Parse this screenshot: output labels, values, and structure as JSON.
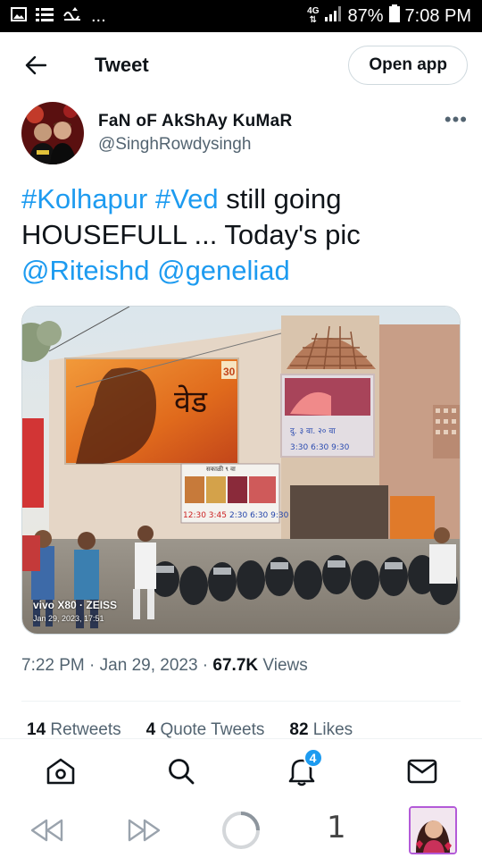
{
  "status_bar": {
    "network": "4G",
    "battery": "87%",
    "time": "7:08 PM",
    "more": "..."
  },
  "header": {
    "title": "Tweet",
    "open_app_label": "Open app"
  },
  "author": {
    "display_name": "FaN oF AkShAy KuMaR",
    "handle": "@SinghRowdysingh",
    "more_label": "•••"
  },
  "tweet": {
    "hashtag1": "#Kolhapur",
    "hashtag2": "#Ved",
    "text1": " still going",
    "text2": "HOUSEFULL ... Today's pic",
    "mention1": "@Riteishd",
    "mention2": "@geneliad"
  },
  "photo": {
    "watermark_line1": "vivo X80 · ZEISS",
    "watermark_line2": "Jan 29, 2023, 17:51",
    "poster_text": "वेड",
    "poster_date": "30",
    "board_text1": "सकाळी ९ वा",
    "board_text2": "12:30  3:45",
    "board_text3": "2:30 6:30 9:30",
    "side_text1": "दु. ३ वा. २० वा",
    "side_text2": "3:30 6:30 9:30"
  },
  "meta": {
    "time": "7:22 PM",
    "sep1": " · ",
    "date": "Jan 29, 2023",
    "sep2": " · ",
    "views_count": "67.7K",
    "views_label": " Views"
  },
  "stats": {
    "retweets_count": "14",
    "retweets_label": " Retweets",
    "quotes_count": "4",
    "quotes_label": " Quote Tweets",
    "likes_count": "82",
    "likes_label": " Likes"
  },
  "bottom_nav": {
    "home_icon": "home-icon",
    "search_icon": "search-icon",
    "notifications_icon": "bell-icon",
    "notifications_badge": "4",
    "messages_icon": "mail-icon"
  },
  "system_nav": {
    "tab_count": "1"
  },
  "colors": {
    "link": "#1d9bf0",
    "text": "#0f1419",
    "muted": "#536471",
    "thumb_border": "#b35ad8"
  }
}
